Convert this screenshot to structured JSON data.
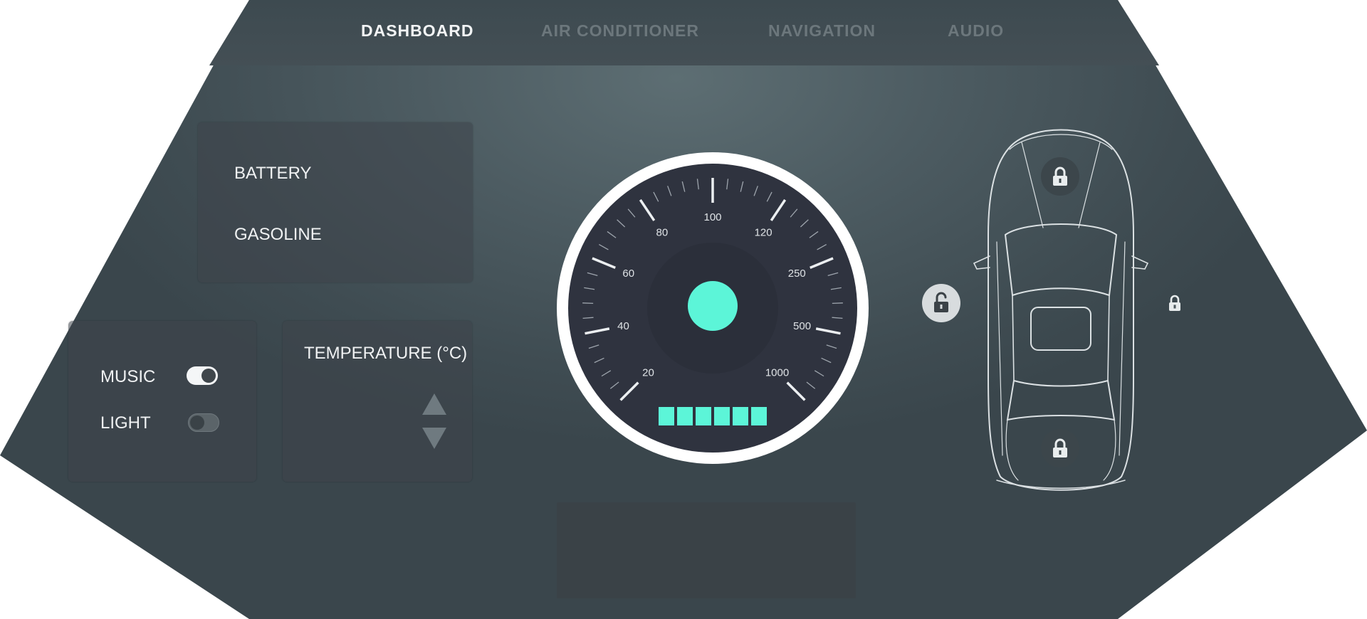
{
  "nav": {
    "tabs": [
      {
        "label": "DASHBOARD",
        "active": true
      },
      {
        "label": "AIR CONDITIONER",
        "active": false
      },
      {
        "label": "NAVIGATION",
        "active": false
      },
      {
        "label": "AUDIO",
        "active": false
      }
    ]
  },
  "energy_panel": {
    "battery_label": "BATTERY",
    "gasoline_label": "GASOLINE"
  },
  "controls_panel": {
    "music_label": "MUSIC",
    "music_on": true,
    "light_label": "LIGHT",
    "light_on": false
  },
  "temperature_panel": {
    "label": "TEMPERATURE (°C)"
  },
  "speedometer": {
    "tick_labels": [
      "20",
      "40",
      "60",
      "80",
      "100",
      "120",
      "250",
      "500",
      "1000"
    ],
    "bar_segments": 6,
    "accent_color": "#5cf5d8",
    "ring_color": "#ffffff",
    "dial_color": "#2f333f"
  },
  "car": {
    "locks": [
      {
        "name": "front",
        "state": "locked"
      },
      {
        "name": "rear",
        "state": "locked"
      },
      {
        "name": "left",
        "state": "unlocked"
      },
      {
        "name": "right",
        "state": "locked"
      }
    ]
  },
  "colors": {
    "panel_text": "#f0f2f3",
    "tab_inactive": "#6c777c",
    "tab_active": "#f2f4f5"
  }
}
